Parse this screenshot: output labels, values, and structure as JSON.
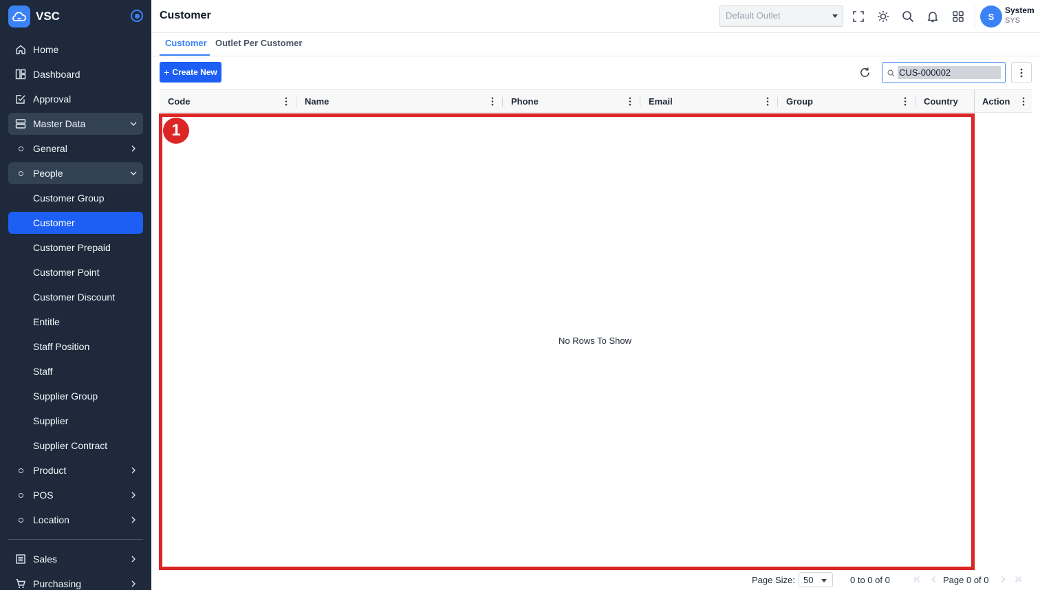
{
  "app": {
    "name": "VSC"
  },
  "sidebar": {
    "items": [
      {
        "label": "Home",
        "icon": "home-icon"
      },
      {
        "label": "Dashboard",
        "icon": "dashboard-icon"
      },
      {
        "label": "Approval",
        "icon": "approval-icon"
      },
      {
        "label": "Master Data",
        "icon": "server-icon"
      },
      {
        "label": "General"
      },
      {
        "label": "People"
      },
      {
        "label": "Customer Group"
      },
      {
        "label": "Customer"
      },
      {
        "label": "Customer Prepaid"
      },
      {
        "label": "Customer Point"
      },
      {
        "label": "Customer Discount"
      },
      {
        "label": "Entitle"
      },
      {
        "label": "Staff Position"
      },
      {
        "label": "Staff"
      },
      {
        "label": "Supplier Group"
      },
      {
        "label": "Supplier"
      },
      {
        "label": "Supplier Contract"
      },
      {
        "label": "Product"
      },
      {
        "label": "POS"
      },
      {
        "label": "Location"
      },
      {
        "label": "Sales",
        "icon": "sales-icon"
      },
      {
        "label": "Purchasing",
        "icon": "cart-icon"
      }
    ]
  },
  "header": {
    "title": "Customer",
    "outlet_placeholder": "Default Outlet",
    "user": {
      "initial": "S",
      "name": "System",
      "code": "SYS"
    }
  },
  "tabs": [
    {
      "label": "Customer"
    },
    {
      "label": "Outlet Per Customer"
    }
  ],
  "toolbar": {
    "create_label": "Create New",
    "search_value": "CUS-000002"
  },
  "grid": {
    "columns": [
      "Code",
      "Name",
      "Phone",
      "Email",
      "Group",
      "Country"
    ],
    "action_column": "Action",
    "empty_text": "No Rows To Show"
  },
  "annotation": {
    "number": "1"
  },
  "footer": {
    "page_size_label": "Page Size:",
    "page_size": "50",
    "range_text": "0 to 0 of 0",
    "page_text": "Page 0 of 0"
  },
  "colors": {
    "sidebar_bg": "#1e293b",
    "accent": "#1d5ff5",
    "highlight": "#dc2626"
  }
}
